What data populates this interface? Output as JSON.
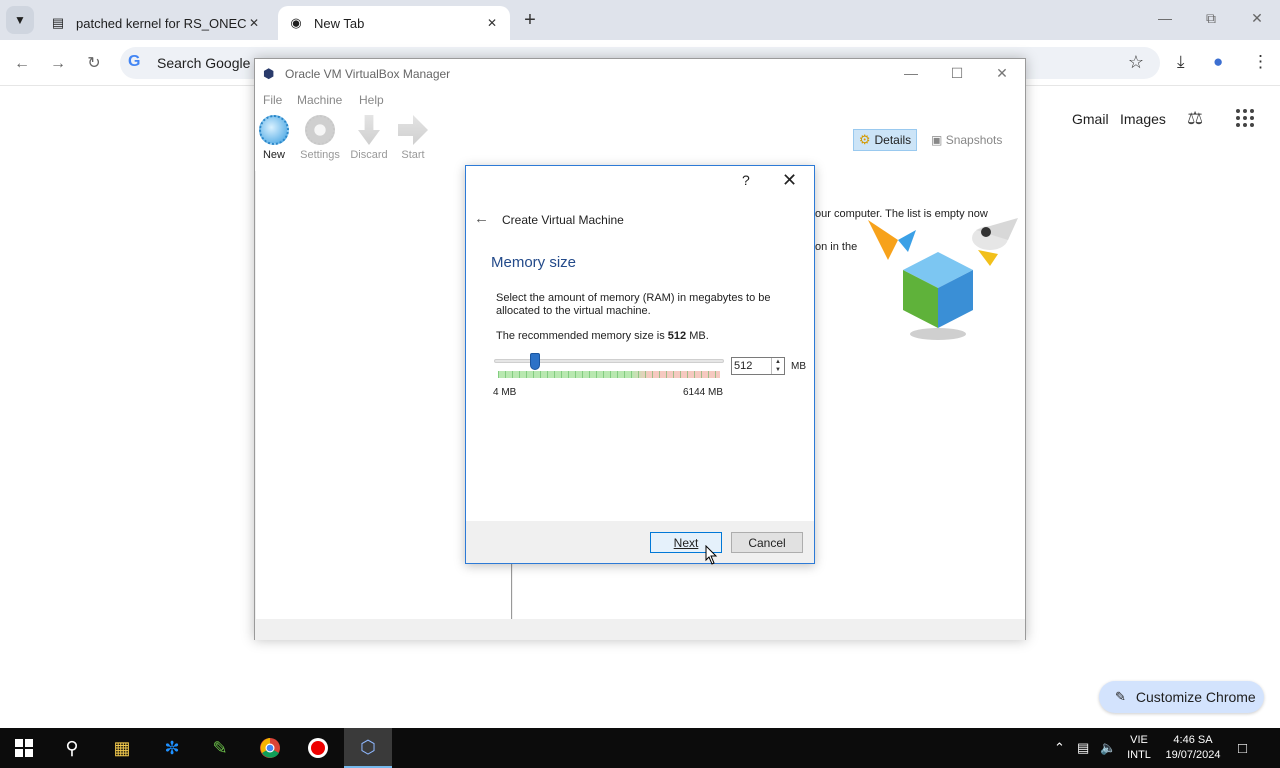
{
  "browser": {
    "tabs": [
      {
        "label": "patched kernel for RS_ONECOR",
        "active": false
      },
      {
        "label": "New Tab",
        "active": true
      }
    ],
    "omnibox_placeholder": "Search Google o",
    "page_links": {
      "gmail": "Gmail",
      "images": "Images"
    },
    "customize_label": "Customize Chrome"
  },
  "vbox": {
    "title": "Oracle VM VirtualBox Manager",
    "menu": [
      "File",
      "Machine",
      "Help"
    ],
    "tools": [
      "New",
      "Settings",
      "Discard",
      "Start"
    ],
    "details_label": "Details",
    "snapshots_label": "Snapshots",
    "welcome_line1": "our computer. The list is empty now",
    "welcome_line2": "on in the"
  },
  "dialog": {
    "help_glyph": "?",
    "header": "Create Virtual Machine",
    "section_title": "Memory size",
    "description": "Select the amount of memory (RAM) in megabytes to be allocated to the virtual machine.",
    "recommended_prefix": "The recommended memory size is ",
    "recommended_value": "512",
    "recommended_suffix": " MB.",
    "slider": {
      "min_label": "4 MB",
      "max_label": "6144 MB",
      "min": 4,
      "max": 6144,
      "value": 512
    },
    "memory_value": "512",
    "unit": "MB",
    "next_label": "Next",
    "cancel_label": "Cancel"
  },
  "taskbar": {
    "language_line1": "VIE",
    "language_line2": "INTL",
    "time": "4:46 SA",
    "date": "19/07/2024"
  },
  "colors": {
    "accent": "#2d7ad6",
    "section_title": "#234a8a",
    "customize_bg": "#d3e3fd"
  }
}
